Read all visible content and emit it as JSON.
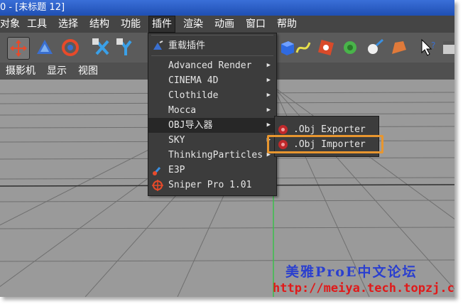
{
  "window": {
    "title": "0 - [未标题 12]"
  },
  "menubar": {
    "items": [
      "对象",
      "工具",
      "选择",
      "结构",
      "功能",
      "插件",
      "渲染",
      "动画",
      "窗口",
      "帮助"
    ],
    "active_index": 5
  },
  "toolbar": {
    "icons": [
      "move-tool-icon",
      "scale-tool-icon",
      "rotate-tool-icon",
      "x-axis-lock-icon",
      "y-axis-lock-icon",
      "plugin-icon",
      "cube-icon",
      "spline-icon",
      "nurbs-icon",
      "array-icon",
      "light-icon",
      "deformer-icon",
      "help-icon",
      "render-icon"
    ]
  },
  "view_menu": {
    "items": [
      "摄影机",
      "显示",
      "视图"
    ]
  },
  "plugins_menu": {
    "items": [
      {
        "label": "重载插件",
        "has_submenu": false,
        "icon": "reload-plugins-icon"
      },
      {
        "label": "Advanced Render",
        "has_submenu": true
      },
      {
        "label": "CINEMA 4D",
        "has_submenu": true
      },
      {
        "label": "Clothilde",
        "has_submenu": true
      },
      {
        "label": "Mocca",
        "has_submenu": true
      },
      {
        "label": "OBJ导入器",
        "has_submenu": true,
        "highlighted": true
      },
      {
        "label": "SKY",
        "has_submenu": true
      },
      {
        "label": "ThinkingParticles",
        "has_submenu": true
      },
      {
        "label": "E3P",
        "has_submenu": false,
        "icon": "e3p-icon"
      },
      {
        "label": "Sniper Pro 1.01",
        "has_submenu": false,
        "icon": "crosshair-icon"
      }
    ]
  },
  "obj_submenu": {
    "items": [
      ".Obj Exporter",
      ".Obj Importer"
    ],
    "highlighted_index": 1
  },
  "watermark": {
    "line1": "美雅ProE中文论坛",
    "line2": "http://meiya.tech.topzj.com"
  },
  "colors": {
    "accent": "#e8962f",
    "watermark_blue": "#2a3fcf",
    "watermark_red": "#e01a1a"
  }
}
